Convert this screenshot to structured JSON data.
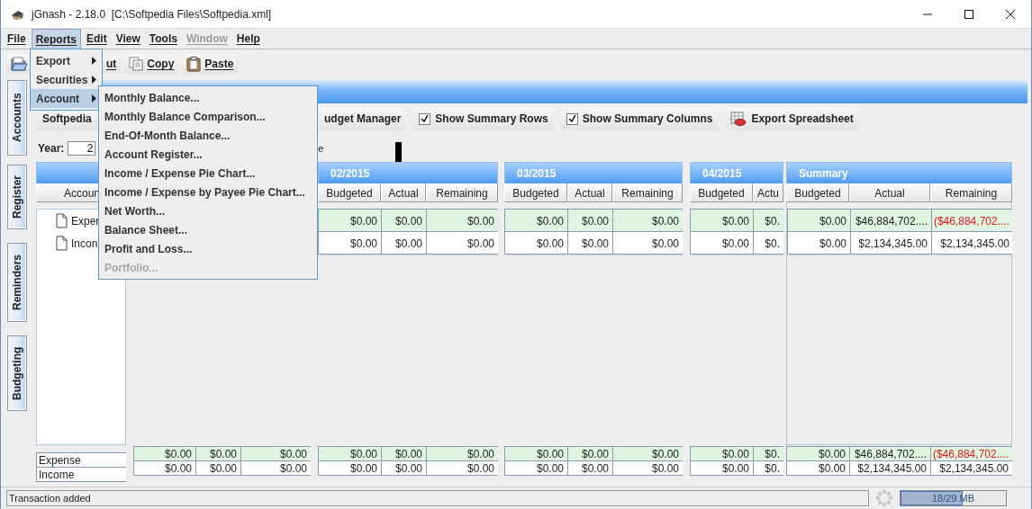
{
  "window": {
    "title": "jGnash - 2.18.0  [C:\\Softpedia Files\\Softpedia.xml]"
  },
  "menu_bar": [
    {
      "label": "File",
      "selected": false,
      "disabled": false
    },
    {
      "label": "Reports",
      "selected": true,
      "disabled": false
    },
    {
      "label": "Edit",
      "selected": false,
      "disabled": false
    },
    {
      "label": "View",
      "selected": false,
      "disabled": false
    },
    {
      "label": "Tools",
      "selected": false,
      "disabled": false
    },
    {
      "label": "Window",
      "selected": false,
      "disabled": true
    },
    {
      "label": "Help",
      "selected": false,
      "disabled": false
    }
  ],
  "toolbar": [
    {
      "kind": "open"
    },
    {
      "kind": "cut",
      "label": "ut"
    },
    {
      "kind": "copy",
      "label": "Copy"
    },
    {
      "kind": "paste",
      "label": "Paste"
    }
  ],
  "reports_menu": {
    "items": [
      {
        "label": "Export",
        "selected": false
      },
      {
        "label": "Securities",
        "selected": false
      },
      {
        "label": "Account",
        "selected": true
      }
    ],
    "submenu": [
      {
        "label": "Monthly Balance...",
        "disabled": false
      },
      {
        "label": "Monthly Balance Comparison...",
        "disabled": false
      },
      {
        "label": "End-Of-Month Balance...",
        "disabled": false
      },
      {
        "label": "Account Register...",
        "disabled": false
      },
      {
        "label": "Income / Expense Pie Chart...",
        "disabled": false
      },
      {
        "label": "Income / Expense by Payee Pie Chart...",
        "disabled": false
      },
      {
        "label": "Net Worth...",
        "disabled": false
      },
      {
        "label": "Balance Sheet...",
        "disabled": false
      },
      {
        "label": "Profit and Loss...",
        "disabled": false
      },
      {
        "label": "Portfolio...",
        "disabled": true
      }
    ]
  },
  "side_tabs": [
    "Accounts",
    "Register",
    "Reminders",
    "Budgeting"
  ],
  "budget_toolbar": [
    {
      "kind": "button",
      "label": "Softpedia"
    },
    {
      "kind": "button",
      "label": "udget Manager"
    },
    {
      "kind": "checkbox",
      "label": "Show Summary Rows",
      "checked": true
    },
    {
      "kind": "checkbox",
      "label": "Show Summary Columns",
      "checked": true
    },
    {
      "kind": "icon_button",
      "label": "Export Spreadsheet"
    }
  ],
  "year": {
    "label": "Year:",
    "value": "2"
  },
  "note": "e",
  "budget_table": {
    "account_header": "Accoun",
    "accounts": [
      "Exper",
      "Incon"
    ],
    "summary_labels": [
      "Expense",
      "Income"
    ],
    "groups": [
      {
        "kind": "period",
        "summary_rows": [
          [
            "$0.00",
            "$0.00",
            "$0.00"
          ],
          [
            "$0.00",
            "$0.00",
            "$0.00"
          ]
        ]
      },
      {
        "kind": "period",
        "title": "02/2015",
        "columns": [
          "Budgeted",
          "Actual",
          "Remaining"
        ],
        "rows": [
          [
            "$0.00",
            "$0.00",
            "$0.00"
          ],
          [
            "$0.00",
            "$0.00",
            "$0.00"
          ]
        ],
        "summary_rows": [
          [
            "$0.00",
            "$0.00",
            "$0.00"
          ],
          [
            "$0.00",
            "$0.00",
            "$0.00"
          ]
        ]
      },
      {
        "kind": "period",
        "title": "03/2015",
        "columns": [
          "Budgeted",
          "Actual",
          "Remaining"
        ],
        "rows": [
          [
            "$0.00",
            "$0.00",
            "$0.00"
          ],
          [
            "$0.00",
            "$0.00",
            "$0.00"
          ]
        ],
        "summary_rows": [
          [
            "$0.00",
            "$0.00",
            "$0.00"
          ],
          [
            "$0.00",
            "$0.00",
            "$0.00"
          ]
        ]
      },
      {
        "kind": "period",
        "title": "04/2015",
        "columns": [
          "Budgeted",
          "Actu"
        ],
        "rows": [
          [
            "$0.00",
            "$0."
          ],
          [
            "$0.00",
            "$0."
          ]
        ],
        "summary_rows": [
          [
            "$0.00",
            "$0."
          ],
          [
            "$0.00",
            "$0."
          ]
        ]
      },
      {
        "kind": "summary",
        "title": "Summary",
        "columns": [
          "Budgeted",
          "Actual",
          "Remaining"
        ],
        "rows": [
          [
            "$0.00",
            "$46,884,702....",
            {
              "text": "($46,884,702....",
              "negative": true
            }
          ],
          [
            "$0.00",
            "$2,134,345.00",
            "$2,134,345.00"
          ]
        ],
        "summary_rows": [
          [
            "$0.00",
            "$46,884,702....",
            {
              "text": "($46,884,702....",
              "negative": true
            }
          ],
          [
            "$0.00",
            "$2,134,345.00",
            "$2,134,345.00"
          ]
        ]
      }
    ]
  },
  "status_bar": {
    "message": "Transaction added",
    "memory": {
      "level": 0.59,
      "reading": "18/29 MB"
    }
  }
}
